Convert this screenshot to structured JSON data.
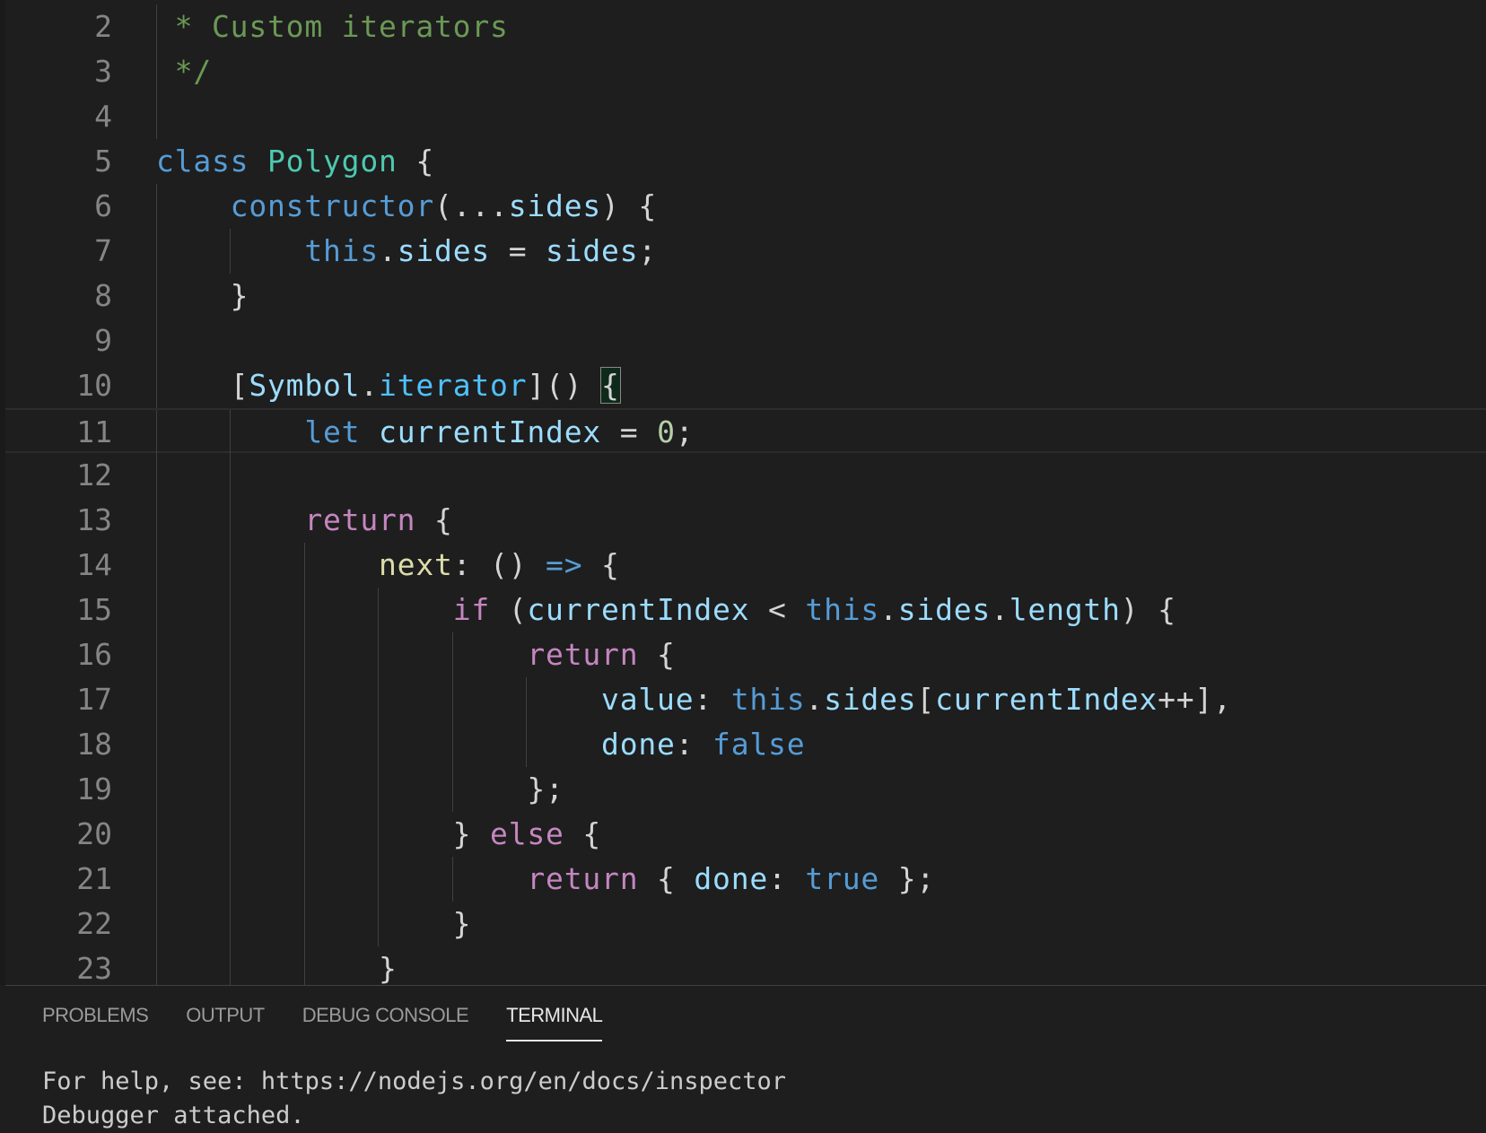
{
  "editor": {
    "current_line": 11,
    "lines": [
      {
        "n": "2",
        "tokens": [
          [
            " * Custom iterators",
            "comment"
          ]
        ]
      },
      {
        "n": "3",
        "tokens": [
          [
            " */",
            "comment"
          ]
        ]
      },
      {
        "n": "4",
        "tokens": []
      },
      {
        "n": "5",
        "tokens": [
          [
            "class",
            "kw"
          ],
          [
            " ",
            "punc"
          ],
          [
            "Polygon",
            "cls"
          ],
          [
            " {",
            "punc"
          ]
        ]
      },
      {
        "n": "6",
        "tokens": [
          [
            "    ",
            "punc"
          ],
          [
            "constructor",
            "kw"
          ],
          [
            "(...",
            "punc"
          ],
          [
            "sides",
            "var"
          ],
          [
            ") {",
            "punc"
          ]
        ]
      },
      {
        "n": "7",
        "tokens": [
          [
            "        ",
            "punc"
          ],
          [
            "this",
            "kw"
          ],
          [
            ".",
            "punc"
          ],
          [
            "sides",
            "var"
          ],
          [
            " = ",
            "punc"
          ],
          [
            "sides",
            "var"
          ],
          [
            ";",
            "punc"
          ]
        ]
      },
      {
        "n": "8",
        "tokens": [
          [
            "    }",
            "punc"
          ]
        ]
      },
      {
        "n": "9",
        "tokens": []
      },
      {
        "n": "10",
        "tokens": [
          [
            "    [",
            "punc"
          ],
          [
            "Symbol",
            "var"
          ],
          [
            ".",
            "punc"
          ],
          [
            "iterator",
            "prop"
          ],
          [
            "]() ",
            "punc"
          ],
          [
            "{",
            "match"
          ]
        ]
      },
      {
        "n": "11",
        "tokens": [
          [
            "        ",
            "punc"
          ],
          [
            "let",
            "kw"
          ],
          [
            " ",
            "punc"
          ],
          [
            "currentIndex",
            "var"
          ],
          [
            " = ",
            "punc"
          ],
          [
            "0",
            "num"
          ],
          [
            ";",
            "punc"
          ]
        ]
      },
      {
        "n": "12",
        "tokens": []
      },
      {
        "n": "13",
        "tokens": [
          [
            "        ",
            "punc"
          ],
          [
            "return",
            "ctrl"
          ],
          [
            " {",
            "punc"
          ]
        ]
      },
      {
        "n": "14",
        "tokens": [
          [
            "            ",
            "punc"
          ],
          [
            "next",
            "fn"
          ],
          [
            ": () ",
            "punc"
          ],
          [
            "=>",
            "kw"
          ],
          [
            " {",
            "punc"
          ]
        ]
      },
      {
        "n": "15",
        "tokens": [
          [
            "                ",
            "punc"
          ],
          [
            "if",
            "ctrl"
          ],
          [
            " (",
            "punc"
          ],
          [
            "currentIndex",
            "var"
          ],
          [
            " < ",
            "punc"
          ],
          [
            "this",
            "kw"
          ],
          [
            ".",
            "punc"
          ],
          [
            "sides",
            "var"
          ],
          [
            ".",
            "punc"
          ],
          [
            "length",
            "var"
          ],
          [
            ") {",
            "punc"
          ]
        ]
      },
      {
        "n": "16",
        "tokens": [
          [
            "                    ",
            "punc"
          ],
          [
            "return",
            "ctrl"
          ],
          [
            " {",
            "punc"
          ]
        ]
      },
      {
        "n": "17",
        "tokens": [
          [
            "                        ",
            "punc"
          ],
          [
            "value",
            "var"
          ],
          [
            ": ",
            "punc"
          ],
          [
            "this",
            "kw"
          ],
          [
            ".",
            "punc"
          ],
          [
            "sides",
            "var"
          ],
          [
            "[",
            "punc"
          ],
          [
            "currentIndex",
            "var"
          ],
          [
            "++],",
            "punc"
          ]
        ]
      },
      {
        "n": "18",
        "tokens": [
          [
            "                        ",
            "punc"
          ],
          [
            "done",
            "var"
          ],
          [
            ": ",
            "punc"
          ],
          [
            "false",
            "kw"
          ]
        ]
      },
      {
        "n": "19",
        "tokens": [
          [
            "                    };",
            "punc"
          ]
        ]
      },
      {
        "n": "20",
        "tokens": [
          [
            "                } ",
            "punc"
          ],
          [
            "else",
            "ctrl"
          ],
          [
            " {",
            "punc"
          ]
        ]
      },
      {
        "n": "21",
        "tokens": [
          [
            "                    ",
            "punc"
          ],
          [
            "return",
            "ctrl"
          ],
          [
            " { ",
            "punc"
          ],
          [
            "done",
            "var"
          ],
          [
            ": ",
            "punc"
          ],
          [
            "true",
            "kw"
          ],
          [
            " };",
            "punc"
          ]
        ]
      },
      {
        "n": "22",
        "tokens": [
          [
            "                }",
            "punc"
          ]
        ]
      },
      {
        "n": "23",
        "tokens": [
          [
            "            }",
            "punc"
          ]
        ]
      }
    ]
  },
  "panel": {
    "tabs": [
      {
        "label": "PROBLEMS",
        "active": false
      },
      {
        "label": "OUTPUT",
        "active": false
      },
      {
        "label": "DEBUG CONSOLE",
        "active": false
      },
      {
        "label": "TERMINAL",
        "active": true
      }
    ],
    "terminal_lines": [
      "For help, see: https://nodejs.org/en/docs/inspector",
      "Debugger attached."
    ]
  }
}
